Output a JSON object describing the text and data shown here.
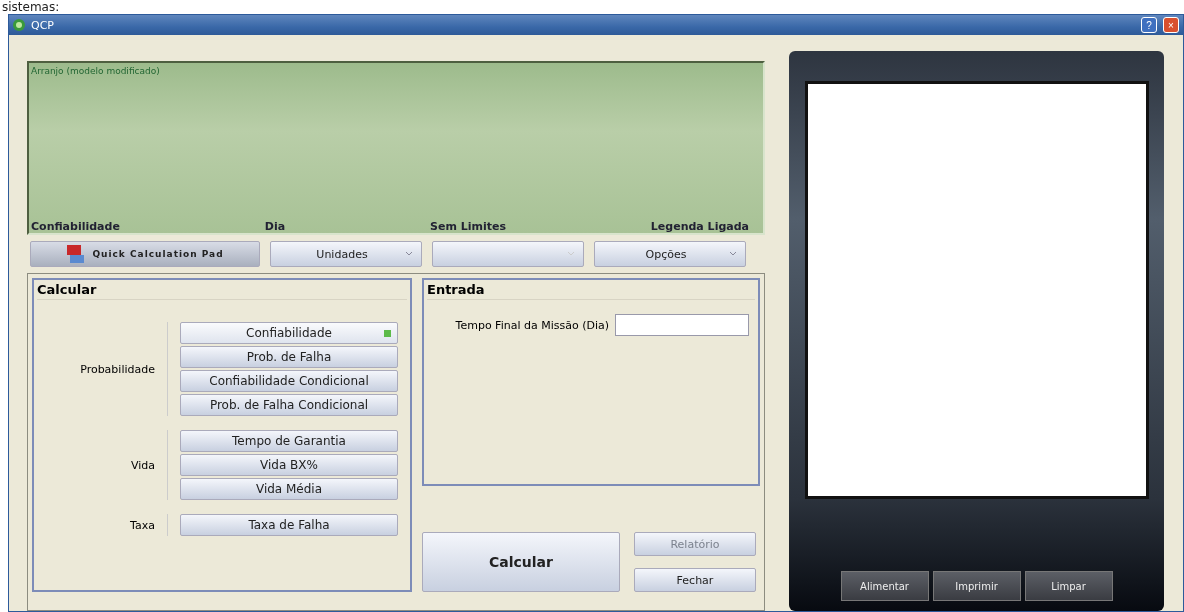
{
  "caption": "sistemas:",
  "window": {
    "title": "QCP",
    "buttons": [
      "?",
      "×"
    ]
  },
  "plot": {
    "title": "Arranjo (modelo modificado)",
    "footer": [
      "Confiabilidade",
      "Dia",
      "Sem Limites",
      "Legenda Ligada"
    ]
  },
  "toolbar": {
    "pad_button": "Quick Calculation Pad",
    "dropdowns": [
      {
        "label": "Unidades",
        "disabled": false
      },
      {
        "disabled": true
      },
      {
        "label": "Opções",
        "disabled": false
      }
    ]
  },
  "calcular": {
    "title": "Calcular",
    "groups": [
      {
        "label": "Probabilidade",
        "buttons": [
          {
            "label": "Confiabilidade",
            "selected": true
          },
          {
            "label": "Prob. de Falha",
            "selected": false
          },
          {
            "label": "Confiabilidade Condicional",
            "selected": false
          },
          {
            "label": "Prob. de Falha Condicional",
            "selected": false
          }
        ]
      },
      {
        "label": "Vida",
        "buttons": [
          {
            "label": "Tempo de Garantia",
            "selected": false
          },
          {
            "label": "Vida BX%",
            "selected": false
          },
          {
            "label": "Vida Média",
            "selected": false
          }
        ]
      },
      {
        "label": "Taxa",
        "buttons": [
          {
            "label": "Taxa de Falha",
            "selected": false
          }
        ]
      }
    ]
  },
  "entrada": {
    "title": "Entrada",
    "fields": [
      {
        "label": "Tempo Final da Missão (Dia)"
      }
    ]
  },
  "actions": {
    "calculate": "Calcular",
    "report": {
      "label": "Relatório",
      "disabled": true
    },
    "close": "Fechar"
  },
  "printer": {
    "buttons": [
      "Alimentar",
      "Imprimir",
      "Limpar"
    ]
  }
}
